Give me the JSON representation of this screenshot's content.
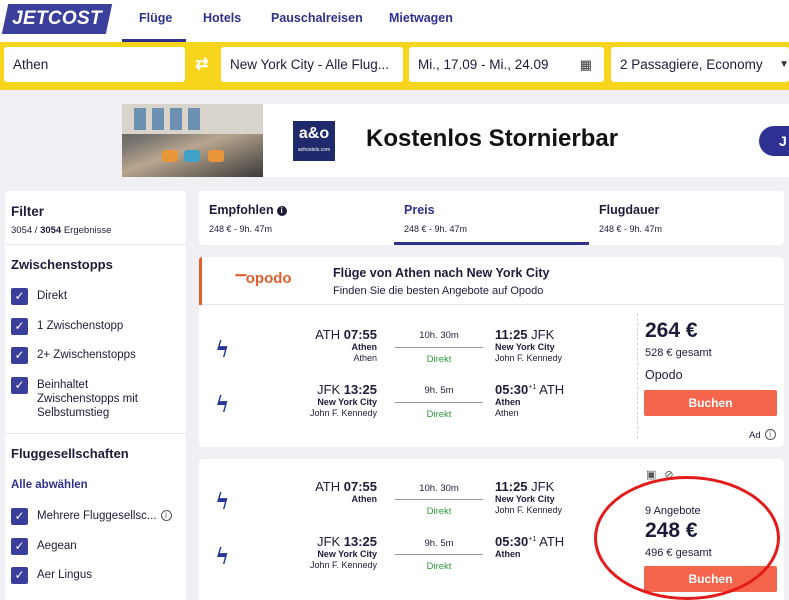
{
  "nav": {
    "logo": "JETCOST",
    "tabs": [
      "Flüge",
      "Hotels",
      "Pauschalreisen",
      "Mietwagen"
    ]
  },
  "search": {
    "origin": "Athen",
    "destination": "New York City - Alle Flug...",
    "dates": "Mi., 17.09 - Mi., 24.09",
    "passengers": "2 Passagiere, Economy"
  },
  "banner": {
    "brand_big": "a&o",
    "brand_small": "aohostels.com",
    "title": "Kostenlos Stornierbar",
    "button": "J"
  },
  "filter": {
    "title": "Filter",
    "count_shown": "3054",
    "count_total": "3054",
    "count_suffix": "Ergebnisse",
    "stops_title": "Zwischenstopps",
    "stops": [
      "Direkt",
      "1 Zwischenstopp",
      "2+ Zwischenstopps",
      "Beinhaltet Zwischenstopps mit Selbstumstieg"
    ],
    "airlines_title": "Fluggesellschaften",
    "deselect_all": "Alle abwählen",
    "airlines": [
      "Mehrere Fluggesellsc...",
      "Aegean",
      "Aer Lingus"
    ]
  },
  "sort": {
    "tabs": [
      {
        "label": "Empfohlen",
        "sub": "248 € - 9h. 47m"
      },
      {
        "label": "Preis",
        "sub": "248 € - 9h. 47m"
      },
      {
        "label": "Flugdauer",
        "sub": "248 € - 9h. 47m"
      }
    ]
  },
  "results": [
    {
      "provider_logo": "opodo",
      "promo_title": "Flüge von Athen nach New York City",
      "promo_sub": "Finden Sie die besten Angebote auf Opodo",
      "outbound": {
        "dep_code": "ATH",
        "dep_time": "07:55",
        "dep_city": "Athen",
        "dep_airport": "Athen",
        "duration": "10h. 30m",
        "stops": "Direkt",
        "arr_time": "11:25",
        "arr_code": "JFK",
        "arr_city": "New York City",
        "arr_airport": "John F. Kennedy",
        "plus_day": ""
      },
      "inbound": {
        "dep_code": "JFK",
        "dep_time": "13:25",
        "dep_city": "New York City",
        "dep_airport": "John F. Kennedy",
        "duration": "9h. 5m",
        "stops": "Direkt",
        "arr_time": "05:30",
        "arr_code": "ATH",
        "arr_city": "Athen",
        "arr_airport": "Athen",
        "plus_day": "+1"
      },
      "price": "264 €",
      "total": "528 € gesamt",
      "provider": "Opodo",
      "button": "Buchen",
      "ad": "Ad"
    },
    {
      "offers": "9 Angebote",
      "outbound": {
        "dep_code": "ATH",
        "dep_time": "07:55",
        "dep_city": "Athen",
        "dep_airport": "",
        "duration": "10h. 30m",
        "stops": "Direkt",
        "arr_time": "11:25",
        "arr_code": "JFK",
        "arr_city": "New York City",
        "arr_airport": "John F. Kennedy",
        "plus_day": ""
      },
      "inbound": {
        "dep_code": "JFK",
        "dep_time": "13:25",
        "dep_city": "New York City",
        "dep_airport": "John F. Kennedy",
        "duration": "9h. 5m",
        "stops": "Direkt",
        "arr_time": "05:30",
        "arr_code": "ATH",
        "arr_city": "Athen",
        "arr_airport": "",
        "plus_day": "+1"
      },
      "price": "248 €",
      "total": "496 € gesamt",
      "button": "Buchen"
    }
  ],
  "colors": {
    "brand": "#2e3192",
    "search_bar": "#f7d51d",
    "buy_button": "#f4654b",
    "direct": "#2e9a3c",
    "highlight": "#e41b1b"
  }
}
